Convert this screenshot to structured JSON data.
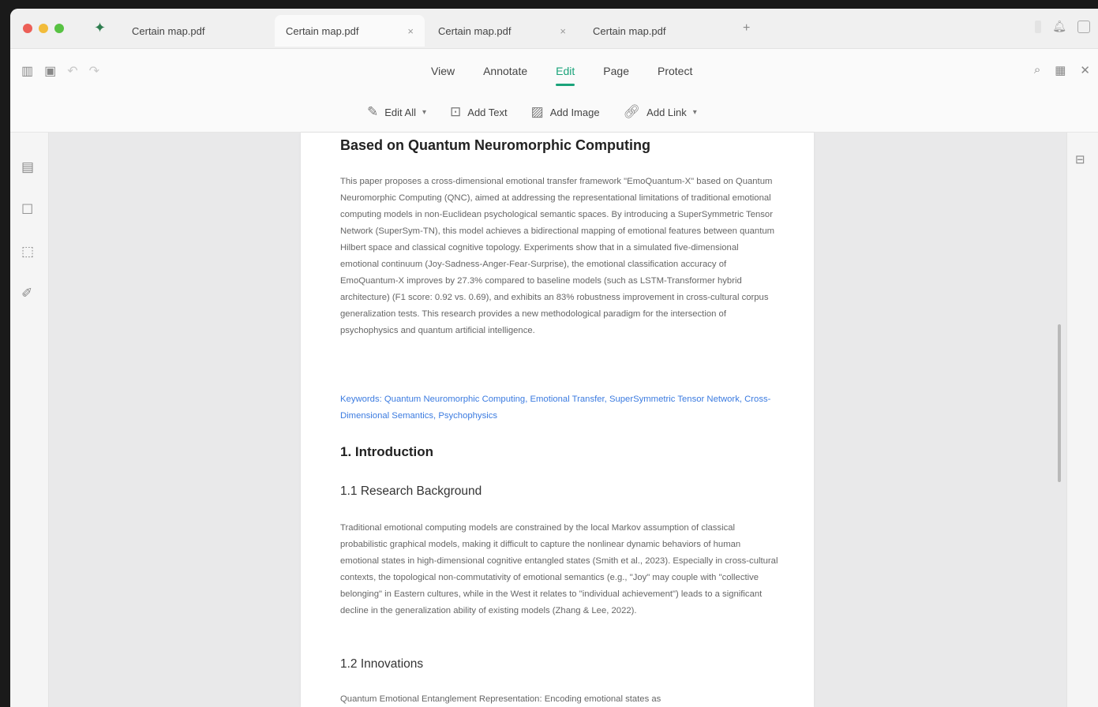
{
  "tabs": [
    {
      "label": "Certain map.pdf",
      "close": ""
    },
    {
      "label": "Certain map.pdf",
      "close": "×"
    },
    {
      "label": "Certain map.pdf",
      "close": "×"
    },
    {
      "label": "Certain map.pdf",
      "close": ""
    }
  ],
  "new_tab": "+",
  "menu": [
    "View",
    "Annotate",
    "Edit",
    "Page",
    "Protect"
  ],
  "active_menu": "Edit",
  "subtoolbar": [
    {
      "label": "Edit All",
      "chevron": "▾",
      "icon": "pen-icon"
    },
    {
      "label": "Add Text",
      "chevron": "",
      "icon": "text-box-icon"
    },
    {
      "label": "Add Image",
      "chevron": "",
      "icon": "image-icon"
    },
    {
      "label": "Add Link",
      "chevron": "▾",
      "icon": "link-icon"
    }
  ],
  "document": {
    "title": "Based on Quantum Neuromorphic Computing",
    "abstract": "This paper proposes a cross-dimensional emotional transfer framework \"EmoQuantum-X\" based on Quantum Neuromorphic Computing (QNC), aimed at addressing the representational limitations of traditional emotional computing models in non-Euclidean psychological semantic spaces. By introducing a SuperSymmetric Tensor Network (SuperSym-TN), this model achieves a bidirectional mapping of emotional features between quantum Hilbert space and classical cognitive topology. Experiments show that in a simulated five-dimensional emotional continuum (Joy-Sadness-Anger-Fear-Surprise), the emotional classification accuracy of EmoQuantum-X improves by 27.3% compared to baseline models (such as LSTM-Transformer hybrid architecture) (F1 score: 0.92 vs. 0.69), and exhibits an 83% robustness improvement in cross-cultural corpus generalization tests. This research provides a new methodological paradigm for the intersection of psychophysics and quantum artificial intelligence.",
    "keywords": "Keywords: Quantum Neuromorphic Computing, Emotional Transfer, SuperSymmetric Tensor Network, Cross-Dimensional Semantics, Psychophysics",
    "section1": "1. Introduction",
    "section1_1": "1.1 Research Background",
    "background": "Traditional emotional computing models are constrained by the local Markov assumption of classical probabilistic graphical models, making it difficult to capture the nonlinear dynamic behaviors of human emotional states in high-dimensional cognitive entangled states (Smith et al., 2023). Especially in cross-cultural contexts, the topological non-commutativity of emotional semantics (e.g., \"Joy\" may couple with \"collective belonging\" in Eastern cultures, while in the West it relates to \"individual achievement\") leads to a significant decline in the generalization ability of existing models (Zhang & Lee, 2022).",
    "section1_2": "1.2 Innovations",
    "innovations": "Quantum Emotional Entanglement Representation: Encoding emotional states as"
  }
}
